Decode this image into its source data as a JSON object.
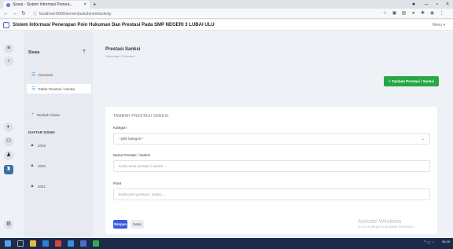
{
  "browser": {
    "tab_title": "Siswa - Sistem Informasi Penera...",
    "url": "localhost:8000/server/punishment/activity"
  },
  "header": {
    "title": "Sistem Informasi Penerapan Poin Hukuman Dan Prestasi Pada SMP NEGERI 3 LUBAI ULU",
    "menu_label": "Menu"
  },
  "sidebar": {
    "heading": "Siswa",
    "items": [
      {
        "label": "Overview"
      },
      {
        "label": "Daftar Prestasi / Sanksi"
      },
      {
        "label": "Tambah Siswa"
      }
    ],
    "section_label": "DAFTAR SISWA",
    "years": [
      "2019",
      "2020",
      "2021"
    ]
  },
  "main": {
    "page_title": "Prestasi Sanksi",
    "breadcrumb": "Hukuman / Overview",
    "add_button_label": "+ Tambah Prestasi / Sanksi",
    "form": {
      "title": "TAMBAH PRESTASI SANKSI",
      "kategori_label": "Kategori",
      "kategori_value": "--pilih kategori--",
      "nama_label": "Nama Prestasi / Sanksi",
      "nama_placeholder": "Ketik nama prestasi / sanksi ...",
      "point_label": "Point",
      "point_placeholder": "Ketik point prestasi / sanksi ...",
      "save_label": "Simpan",
      "reset_label": "Batal"
    }
  },
  "watermark": {
    "line1": "Activate Windows",
    "line2": "Go to Settings to activate Windows."
  },
  "taskbar": {
    "time": "06.20"
  },
  "colors": {
    "primary": "#3b5bdb",
    "success": "#28a745",
    "accent": "#3b6ea5"
  }
}
